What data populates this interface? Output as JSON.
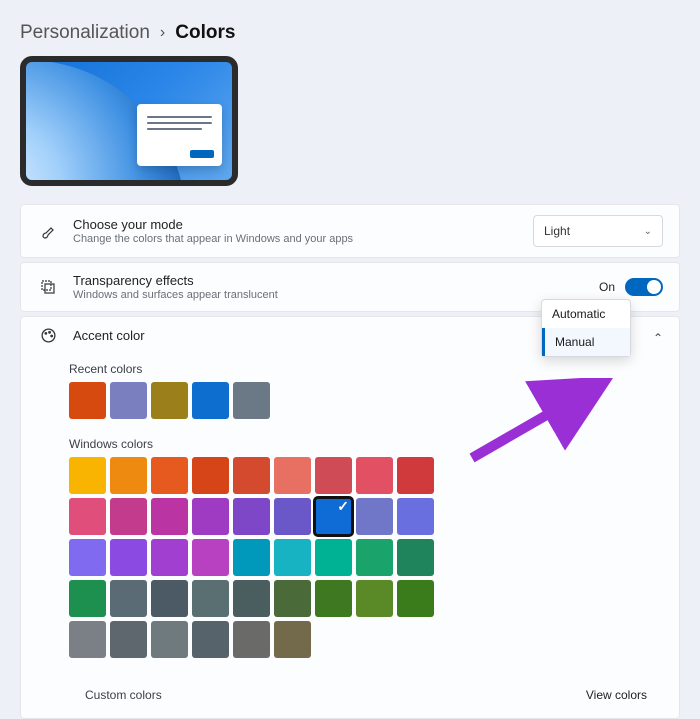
{
  "breadcrumb": {
    "parent": "Personalization",
    "current": "Colors"
  },
  "mode": {
    "title": "Choose your mode",
    "subtitle": "Change the colors that appear in Windows and your apps",
    "value": "Light"
  },
  "transparency": {
    "title": "Transparency effects",
    "subtitle": "Windows and surfaces appear translucent",
    "state_label": "On"
  },
  "accent": {
    "title": "Accent color",
    "dropdown": {
      "options": [
        "Automatic",
        "Manual"
      ],
      "selected": "Manual"
    }
  },
  "recent": {
    "label": "Recent colors",
    "colors": [
      "#d64a0f",
      "#7a7fc0",
      "#9a7f1a",
      "#0d6ed0",
      "#6b7885"
    ]
  },
  "windows_colors": {
    "label": "Windows colors",
    "rows": [
      [
        "#f8b400",
        "#ee8a10",
        "#e65a1f",
        "#d64517",
        "#d44a2f",
        "#e77062",
        "#cf4c57",
        "#e25163"
      ],
      [
        "#d03a3c",
        "#e04e7c",
        "#c33b8c",
        "#ba34a4",
        "#9f3bc2",
        "#7d47c7",
        "#6a58c9",
        "#0f6bd6"
      ],
      [
        "#7077c8",
        "#6a6fe0",
        "#7f6af0",
        "#8b4be2",
        "#a03fd0",
        "#b841c2",
        "#0099bc",
        "#17b3c2"
      ],
      [
        "#00b294",
        "#1aa36a",
        "#1f845c",
        "#1d8f4f",
        "#5a6b76",
        "#4c5a66",
        "#5a6f72",
        "#4a5e60"
      ],
      [
        "#4b6a3a",
        "#3e7820",
        "#5a8a28",
        "#3a7c1c",
        "#7a8085",
        "#5e666e",
        "#6e7a7e",
        "#57636a"
      ],
      [
        "#6a6a68",
        "#726a4a"
      ]
    ],
    "selected_color": "#0f6bd6"
  },
  "custom": {
    "label": "Custom colors",
    "action": "View colors"
  }
}
